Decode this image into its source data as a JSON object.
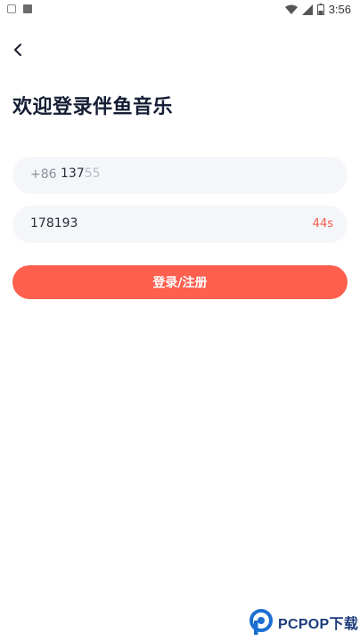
{
  "status_bar": {
    "time": "3:56",
    "icons": [
      "keyboard-icon",
      "a-icon",
      "wifi-icon",
      "signal-icon",
      "battery-icon"
    ]
  },
  "header": {
    "back_icon": "chevron-left-icon"
  },
  "page": {
    "title": "欢迎登录伴鱼音乐"
  },
  "phone_field": {
    "country_code": "+86",
    "value": "137",
    "value_faded": "55"
  },
  "code_field": {
    "value": "178193",
    "countdown": "44s"
  },
  "submit": {
    "label": "登录/注册"
  },
  "watermark": {
    "text": "PCPOP下载"
  },
  "colors": {
    "accent": "#fe5f4f",
    "countdown": "#f15a4a",
    "field_bg": "#f5f6fa",
    "title": "#141d33"
  }
}
